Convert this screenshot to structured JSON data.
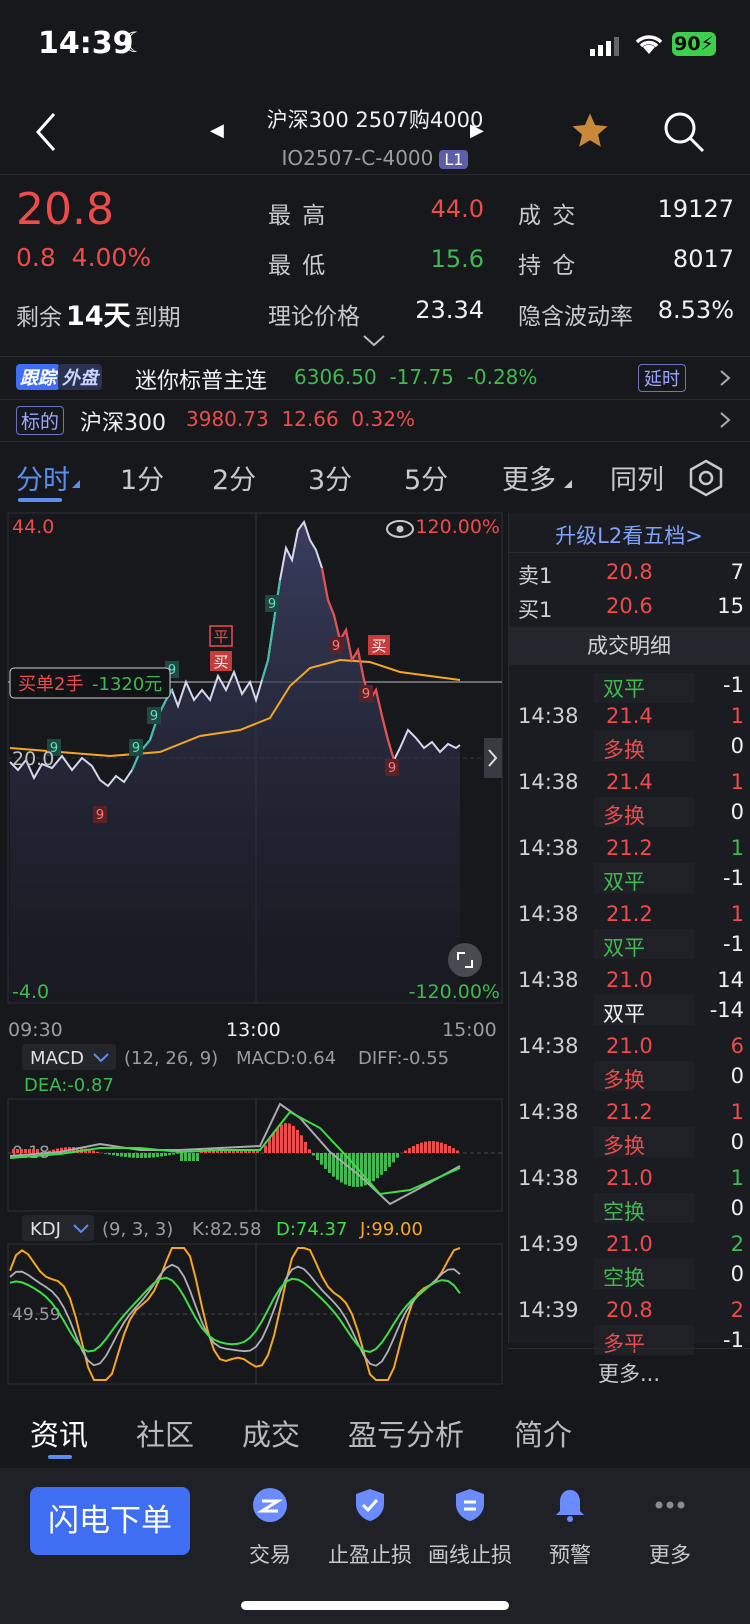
{
  "status_bar": {
    "time": "14:39",
    "battery": "90"
  },
  "header": {
    "title": "沪深300 2507购4000",
    "subtitle": "IO2507-C-4000",
    "level_badge": "L1"
  },
  "quote": {
    "price": "20.8",
    "change": "0.8",
    "change_pct": "4.00%",
    "expiry_prefix": "剩余",
    "expiry_days": "14天",
    "expiry_suffix": "到期",
    "high_label": "最 高",
    "high": "44.0",
    "low_label": "最 低",
    "low": "15.6",
    "theory_label": "理论价格",
    "theory": "23.34",
    "volume_label": "成 交",
    "volume": "19127",
    "oi_label": "持 仓",
    "oi": "8017",
    "iv_label": "隐含波动率",
    "iv": "8.53%"
  },
  "tracker": {
    "tag1": "跟踪",
    "tag2": "外盘",
    "name": "迷你标普主连",
    "price": "6306.50",
    "change": "-17.75",
    "change_pct": "-0.28%",
    "delay_tag": "延时"
  },
  "underlying": {
    "tag": "标的",
    "name": "沪深300",
    "price": "3980.73",
    "change": "12.66",
    "change_pct": "0.32%"
  },
  "period_tabs": [
    "分时",
    "1分",
    "2分",
    "3分",
    "5分",
    "更多",
    "同列"
  ],
  "chart": {
    "y_max": "44.0",
    "y_min": "-4.0",
    "pct_max": "120.00%",
    "pct_min": "-120.00%",
    "ref_price": "20.0",
    "times": [
      "09:30",
      "13:00",
      "15:00"
    ],
    "order_label": "买单2手",
    "order_pnl": "-1320元",
    "sig_flat": "平",
    "sig_buy": "买",
    "macd_name": "MACD",
    "macd_params": "(12, 26, 9)",
    "macd_val": "MACD:0.64",
    "diff_val": "DIFF:-0.55",
    "dea_val": "DEA:-0.87",
    "macd_ref": "0.18",
    "kdj_name": "KDJ",
    "kdj_params": "(9, 3, 3)",
    "k_val": "K:82.58",
    "d_val": "D:74.37",
    "j_val": "J:99.00",
    "kdj_ref": "49.59"
  },
  "l2_panel": {
    "upgrade": "升级L2看五档>",
    "ask_label": "卖1",
    "ask_price": "20.8",
    "ask_vol": "7",
    "bid_label": "买1",
    "bid_price": "20.6",
    "bid_vol": "15",
    "detail_title": "成交明细",
    "more": "更多..."
  },
  "trades": [
    {
      "time": "",
      "price": "",
      "vol": "",
      "type": "双平",
      "oi": "-1"
    },
    {
      "time": "14:38",
      "price": "21.4",
      "vol": "1",
      "type": "多换",
      "oi": "0"
    },
    {
      "time": "14:38",
      "price": "21.4",
      "vol": "1",
      "type": "多换",
      "oi": "0"
    },
    {
      "time": "14:38",
      "price": "21.2",
      "vol": "1",
      "type": "双平",
      "oi": "-1"
    },
    {
      "time": "14:38",
      "price": "21.2",
      "vol": "1",
      "type": "双平",
      "oi": "-1"
    },
    {
      "time": "14:38",
      "price": "21.0",
      "vol": "14",
      "type": "双平",
      "oi": "-14"
    },
    {
      "time": "14:38",
      "price": "21.0",
      "vol": "6",
      "type": "多换",
      "oi": "0"
    },
    {
      "time": "14:38",
      "price": "21.2",
      "vol": "1",
      "type": "多换",
      "oi": "0"
    },
    {
      "time": "14:38",
      "price": "21.0",
      "vol": "1",
      "type": "空换",
      "oi": "0"
    },
    {
      "time": "14:39",
      "price": "21.0",
      "vol": "2",
      "type": "空换",
      "oi": "0"
    },
    {
      "time": "14:39",
      "price": "20.8",
      "vol": "2",
      "type": "多平",
      "oi": "-1"
    }
  ],
  "bottom_tabs": [
    "资讯",
    "社区",
    "成交",
    "盈亏分析",
    "简介"
  ],
  "toolbar": {
    "flash": "闪电下单",
    "items": [
      "交易",
      "止盈止损",
      "画线止损",
      "预警",
      "更多"
    ]
  },
  "colors": {
    "up": "#ee4b4b",
    "down": "#3fb950",
    "accent": "#5b8def",
    "avg_line": "#f5a623"
  }
}
